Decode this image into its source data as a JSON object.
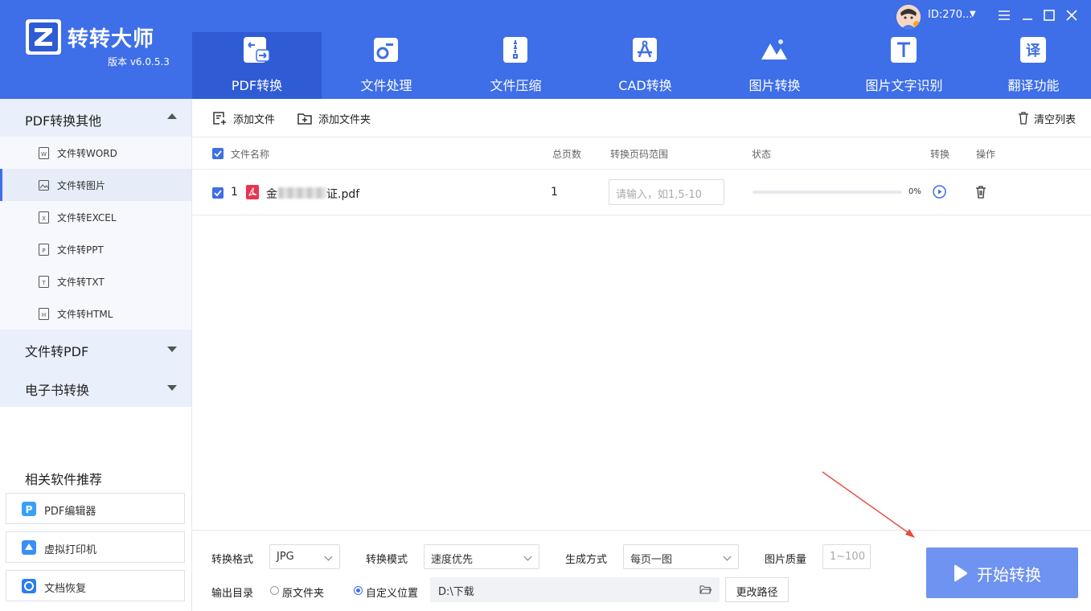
{
  "app": {
    "name": "转转大师",
    "version": "版本 v6.0.5.3",
    "user_id": "ID:270...",
    "colors": {
      "primary": "#3e6ee8",
      "primary_dark": "#2f5bd4",
      "start_button": "#6e93f0",
      "pdf_red": "#e8344e"
    }
  },
  "nav_tabs": [
    {
      "label": "PDF转换",
      "icon": "pdf-convert-icon",
      "active": true
    },
    {
      "label": "文件处理",
      "icon": "file-process-icon"
    },
    {
      "label": "文件压缩",
      "icon": "zip-icon"
    },
    {
      "label": "CAD转换",
      "icon": "cad-icon"
    },
    {
      "label": "图片转换",
      "icon": "image-convert-icon"
    },
    {
      "label": "图片文字识别",
      "icon": "ocr-icon"
    },
    {
      "label": "翻译功能",
      "icon": "translate-icon"
    }
  ],
  "sidebar": {
    "group1": {
      "label": "PDF转换其他",
      "items": [
        {
          "label": "文件转WORD",
          "icon": "word-file-icon"
        },
        {
          "label": "文件转图片",
          "icon": "image-file-icon",
          "active": true
        },
        {
          "label": "文件转EXCEL",
          "icon": "excel-file-icon"
        },
        {
          "label": "文件转PPT",
          "icon": "ppt-file-icon"
        },
        {
          "label": "文件转TXT",
          "icon": "txt-file-icon"
        },
        {
          "label": "文件转HTML",
          "icon": "html-file-icon"
        }
      ]
    },
    "group2": {
      "label": "文件转PDF"
    },
    "group3": {
      "label": "电子书转换"
    },
    "recommend_title": "相关软件推荐",
    "recommend": [
      {
        "label": "PDF编辑器",
        "icon": "pdf-editor-icon"
      },
      {
        "label": "虚拟打印机",
        "icon": "virtual-printer-icon"
      },
      {
        "label": "文档恢复",
        "icon": "doc-recovery-icon"
      }
    ]
  },
  "toolbar": {
    "add_file": "添加文件",
    "add_folder": "添加文件夹",
    "clear_list": "清空列表"
  },
  "table": {
    "headers": {
      "name": "文件名称",
      "pages": "总页数",
      "range": "转换页码范围",
      "status": "状态",
      "convert": "转换",
      "action": "操作"
    },
    "rows": [
      {
        "index": "1",
        "name_prefix": "金",
        "name_suffix": "证.pdf",
        "pages": "1",
        "range_placeholder": "请输入，如1,5-10",
        "progress": 0,
        "progress_text": "0%"
      }
    ]
  },
  "settings": {
    "format_label": "转换格式",
    "format_value": "JPG",
    "mode_label": "转换模式",
    "mode_value": "速度优先",
    "generate_label": "生成方式",
    "generate_value": "每页一图",
    "quality_label": "图片质量",
    "quality_placeholder": "1~100",
    "output_label": "输出目录",
    "option_original": "原文件夹",
    "option_custom": "自定义位置",
    "output_path": "D:\\下载",
    "change_path": "更改路径"
  },
  "start_button": "开始转换"
}
